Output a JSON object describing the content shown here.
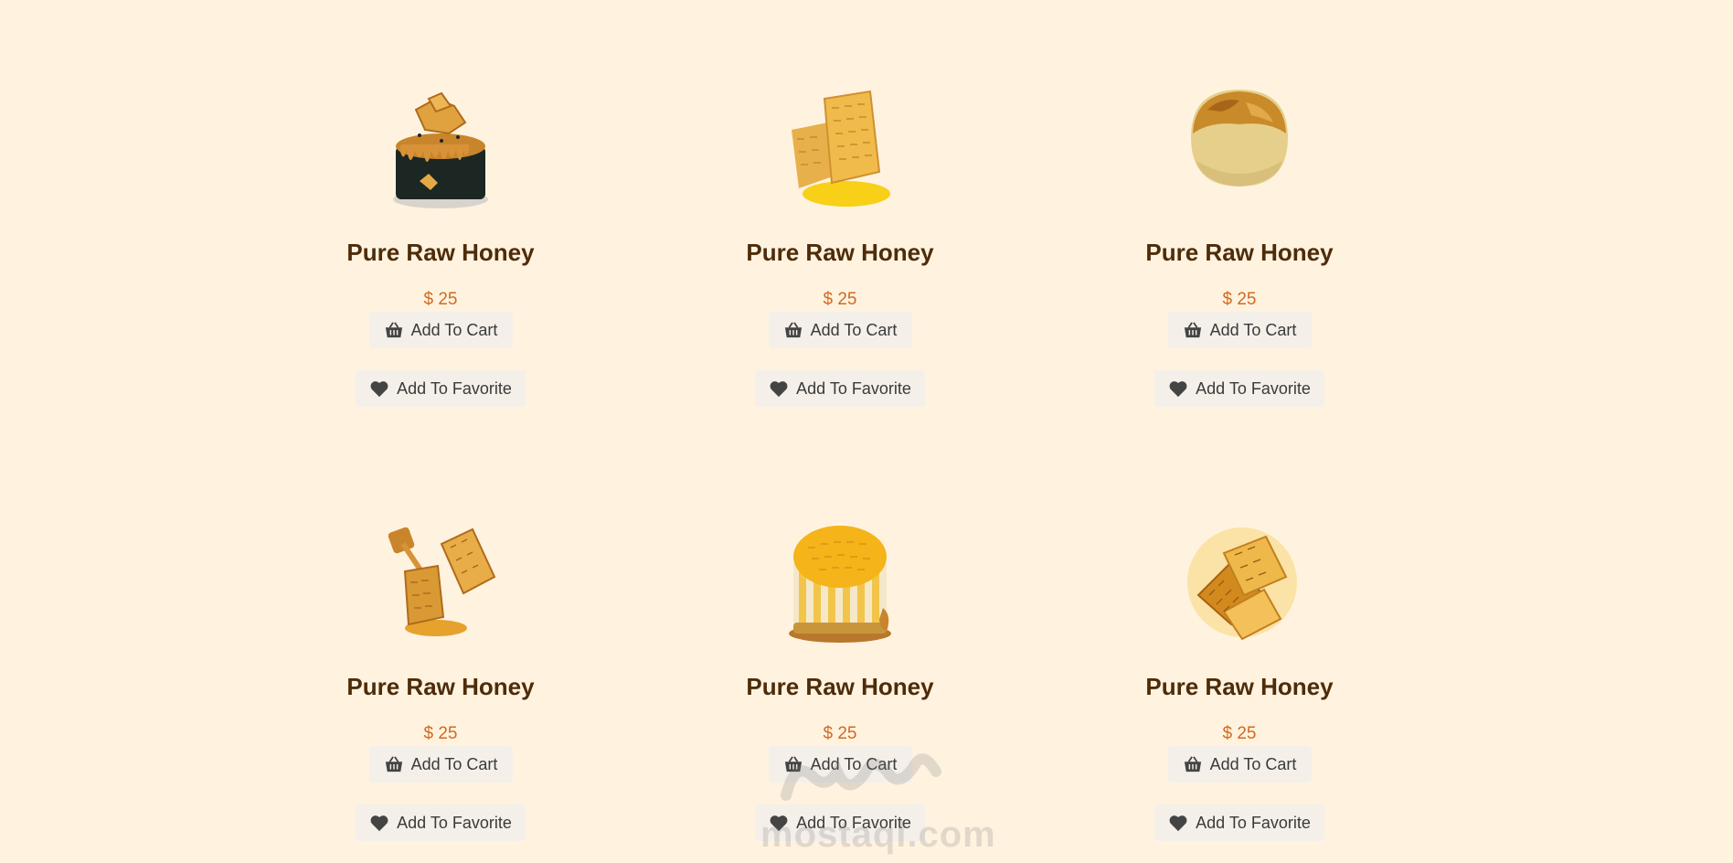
{
  "products": [
    {
      "title": "Pure Raw Honey",
      "price": "$ 25",
      "cart_label": "Add To Cart",
      "favorite_label": "Add To Favorite",
      "image": "honey-drip-cake"
    },
    {
      "title": "Pure Raw Honey",
      "price": "$ 25",
      "cart_label": "Add To Cart",
      "favorite_label": "Add To Favorite",
      "image": "honeycomb-chunks"
    },
    {
      "title": "Pure Raw Honey",
      "price": "$ 25",
      "cart_label": "Add To Cart",
      "favorite_label": "Add To Favorite",
      "image": "golden-pastry"
    },
    {
      "title": "Pure Raw Honey",
      "price": "$ 25",
      "cart_label": "Add To Cart",
      "favorite_label": "Add To Favorite",
      "image": "honeycomb-with-dipper"
    },
    {
      "title": "Pure Raw Honey",
      "price": "$ 25",
      "cart_label": "Add To Cart",
      "favorite_label": "Add To Favorite",
      "image": "honeycomb-cheesecake"
    },
    {
      "title": "Pure Raw Honey",
      "price": "$ 25",
      "cart_label": "Add To Cart",
      "favorite_label": "Add To Favorite",
      "image": "honeycomb-pieces"
    }
  ],
  "icons": {
    "cart": "basket-icon",
    "favorite": "heart-icon"
  },
  "colors": {
    "background": "#fff3e0",
    "title": "#4e2c0a",
    "price": "#d2691e",
    "button_bg": "#f4efe9"
  },
  "watermark": {
    "text": "mostaql.com"
  }
}
